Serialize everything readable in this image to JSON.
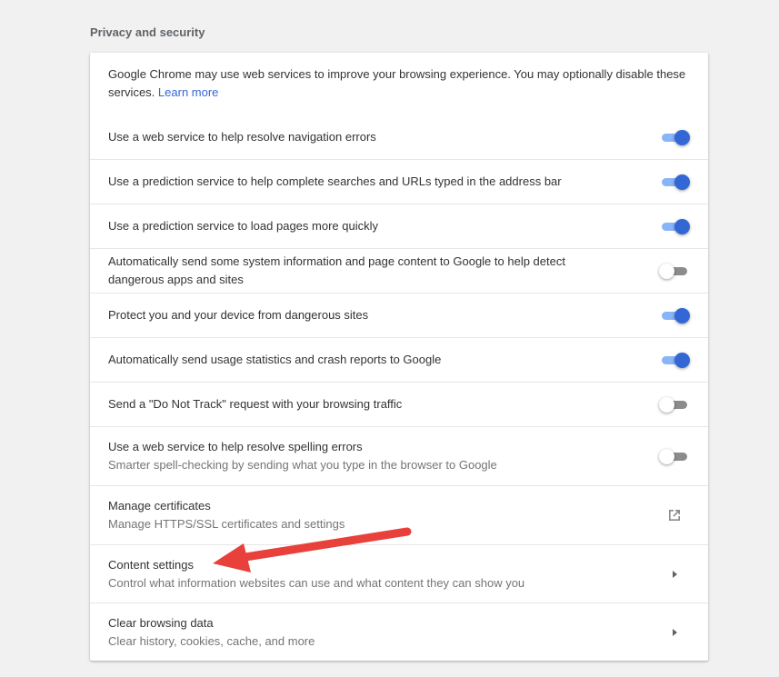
{
  "section": {
    "title": "Privacy and security"
  },
  "intro": {
    "text": "Google Chrome may use web services to improve your browsing experience. You may optionally disable these services.",
    "link": "Learn more"
  },
  "settings": [
    {
      "label": "Use a web service to help resolve navigation errors",
      "sublabel": "",
      "control": "toggle",
      "state": "on"
    },
    {
      "label": "Use a prediction service to help complete searches and URLs typed in the address bar",
      "sublabel": "",
      "control": "toggle",
      "state": "on"
    },
    {
      "label": "Use a prediction service to load pages more quickly",
      "sublabel": "",
      "control": "toggle",
      "state": "on"
    },
    {
      "label": "Automatically send some system information and page content to Google to help detect dangerous apps and sites",
      "sublabel": "",
      "control": "toggle",
      "state": "off"
    },
    {
      "label": "Protect you and your device from dangerous sites",
      "sublabel": "",
      "control": "toggle",
      "state": "on"
    },
    {
      "label": "Automatically send usage statistics and crash reports to Google",
      "sublabel": "",
      "control": "toggle",
      "state": "on"
    },
    {
      "label": "Send a \"Do Not Track\" request with your browsing traffic",
      "sublabel": "",
      "control": "toggle",
      "state": "off"
    },
    {
      "label": "Use a web service to help resolve spelling errors",
      "sublabel": "Smarter spell-checking by sending what you type in the browser to Google",
      "control": "toggle",
      "state": "off"
    },
    {
      "label": "Manage certificates",
      "sublabel": "Manage HTTPS/SSL certificates and settings",
      "control": "external-link-icon"
    },
    {
      "label": "Content settings",
      "sublabel": "Control what information websites can use and what content they can show you",
      "control": "chevron-right-icon"
    },
    {
      "label": "Clear browsing data",
      "sublabel": "Clear history, cookies, cache, and more",
      "control": "chevron-right-icon"
    }
  ],
  "colors": {
    "toggle_on_knob": "#3367d6",
    "toggle_on_track": "#8ab4f8",
    "toggle_off_track": "#8c8c8c",
    "link": "#3367d6",
    "annotation_arrow": "#e8403a"
  }
}
